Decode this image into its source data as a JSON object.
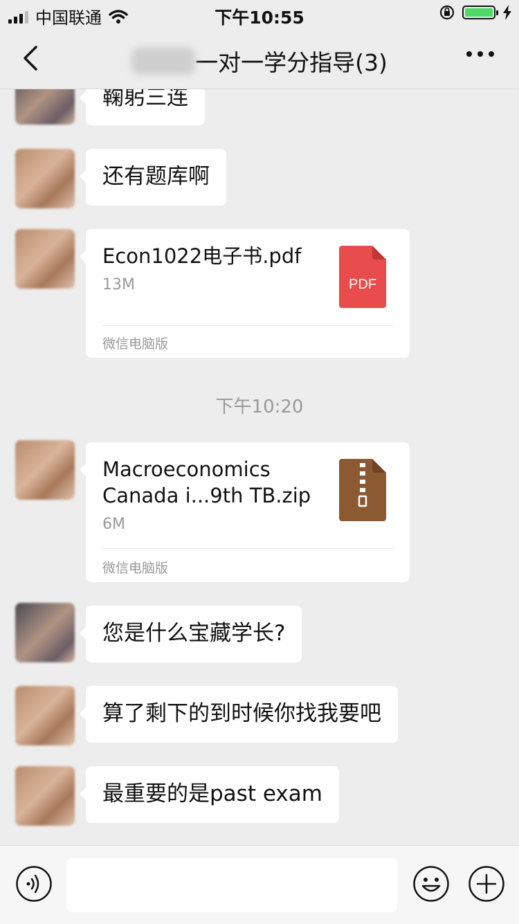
{
  "status_bar": {
    "carrier": "中国联通",
    "time": "下午10:55"
  },
  "nav": {
    "title": "一对一学分指导(3)",
    "back_icon": "chevron-left-icon",
    "more_icon": "more-dots-icon"
  },
  "messages": {
    "m0": {
      "text": "鞠躬三连"
    },
    "m1": {
      "text": "还有题库啊"
    },
    "f1": {
      "name": "Econ1022电子书.pdf",
      "size": "13M",
      "source": "微信电脑版",
      "icon_label": "PDF",
      "icon_color": "#e84c4c"
    },
    "timestamp": "下午10:20",
    "f2": {
      "name": "Macroeconomics\nCanada i...9th TB.zip",
      "size": "6M",
      "source": "微信电脑版",
      "icon_color": "#8b5a33"
    },
    "m2": {
      "text": "您是什么宝藏学长?"
    },
    "m3": {
      "text": "算了剩下的到时候你找我要吧"
    },
    "m4": {
      "text": "最重要的是past exam"
    }
  },
  "input_bar": {
    "voice_icon": "voice-icon",
    "emoji_icon": "emoji-icon",
    "plus_icon": "plus-icon"
  }
}
